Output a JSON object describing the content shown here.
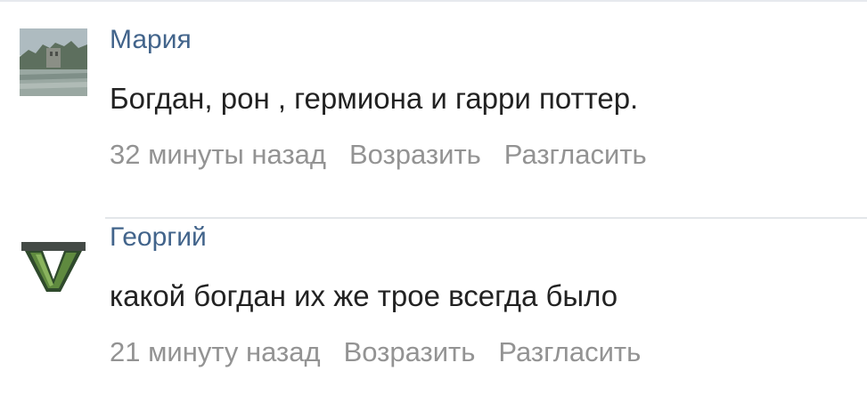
{
  "comments": [
    {
      "author": "Мария",
      "text": "Богдан, рон , гермиона и гарри поттер.",
      "time": "32 минуты назад",
      "actions": [
        "Возразить",
        "Разгласить"
      ]
    },
    {
      "author": "Георгий",
      "text": "какой богдан их же трое всегда было",
      "time": "21 минуту назад",
      "actions": [
        "Возразить",
        "Разгласить"
      ]
    }
  ],
  "colors": {
    "author_link": "#42648b",
    "body_text": "#222222",
    "meta_text": "#939393",
    "divider": "#e3e6ea"
  },
  "icons": [
    "landscape-avatar-icon",
    "gta-v-logo-icon"
  ]
}
